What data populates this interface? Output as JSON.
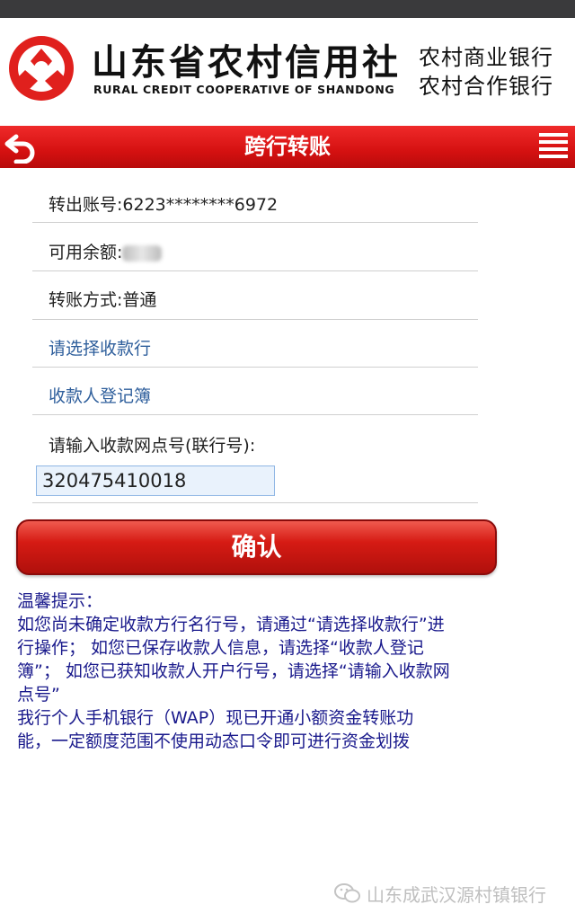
{
  "header": {
    "bank_name_cn": "山东省农村信用社",
    "bank_name_en": "RURAL CREDIT COOPERATIVE OF SHANDONG",
    "sub_line1": "农村商业银行",
    "sub_line2": "农村合作银行"
  },
  "title_bar": {
    "title": "跨行转账",
    "back_icon": "back-arrow-icon",
    "menu_icon": "menu-list-icon"
  },
  "form": {
    "from_account": "转出账号:6223********6972",
    "balance_label": "可用余额:",
    "transfer_method": "转账方式:普通",
    "select_bank_link": "请选择收款行",
    "payee_book_link": "收款人登记簿",
    "bank_code_label": "请输入收款网点号(联行号):",
    "bank_code_value": "320475410018"
  },
  "confirm_label": "确认",
  "tips": {
    "title": "温馨提示：",
    "lines": [
      "如您尚未确定收款方行名行号，请通过“请选择收款行”进",
      "行操作； 如您已保存收款人信息，请选择“收款人登记",
      "簿”； 如您已获知收款人开户行号，请选择“请输入收款网",
      "点号”",
      "我行个人手机银行（WAP）现已开通小额资金转账功",
      "能，一定额度范围不使用动态口令即可进行资金划拨"
    ]
  },
  "watermark": "山东成武汉源村镇银行",
  "colors": {
    "brand_red": "#d51111",
    "link_blue": "#2f5f9c",
    "tips_blue": "#1a1a8c"
  }
}
